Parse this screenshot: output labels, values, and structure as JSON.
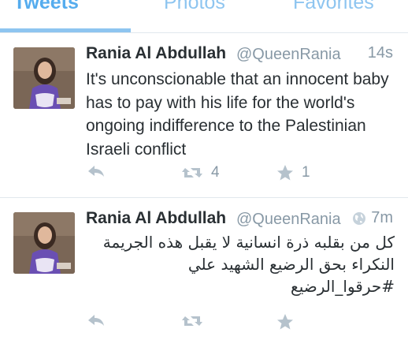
{
  "tabs": [
    {
      "label": "Tweets"
    },
    {
      "label": "Photos"
    },
    {
      "label": "Favorites"
    }
  ],
  "active_tab": "Tweets",
  "colors": {
    "accent": "#55acee",
    "muted": "#8899a6",
    "text": "#292f33",
    "divider": "#e1e8ed"
  },
  "tweets": [
    {
      "name": "Rania Al Abdullah",
      "handle": "@QueenRania",
      "time": "14s",
      "text": "It's unconscionable that an innocent baby has to pay with his life for the world's ongoing indifference to the Palestinian Israeli conflict",
      "retweets": "4",
      "favorites": "1",
      "icons": {
        "reply": "reply-icon",
        "retweet": "retweet-icon",
        "favorite": "star-icon"
      }
    },
    {
      "name": "Rania Al Abdullah",
      "handle": "@QueenRania",
      "time": "7m",
      "text": "كل من بقلبه ذرة انسانية لا يقبل هذه الجريمة النكراء بحق الرضيع الشهيد علي #حرقوا_الرضيع",
      "icons": {
        "location": "globe-icon"
      }
    }
  ]
}
